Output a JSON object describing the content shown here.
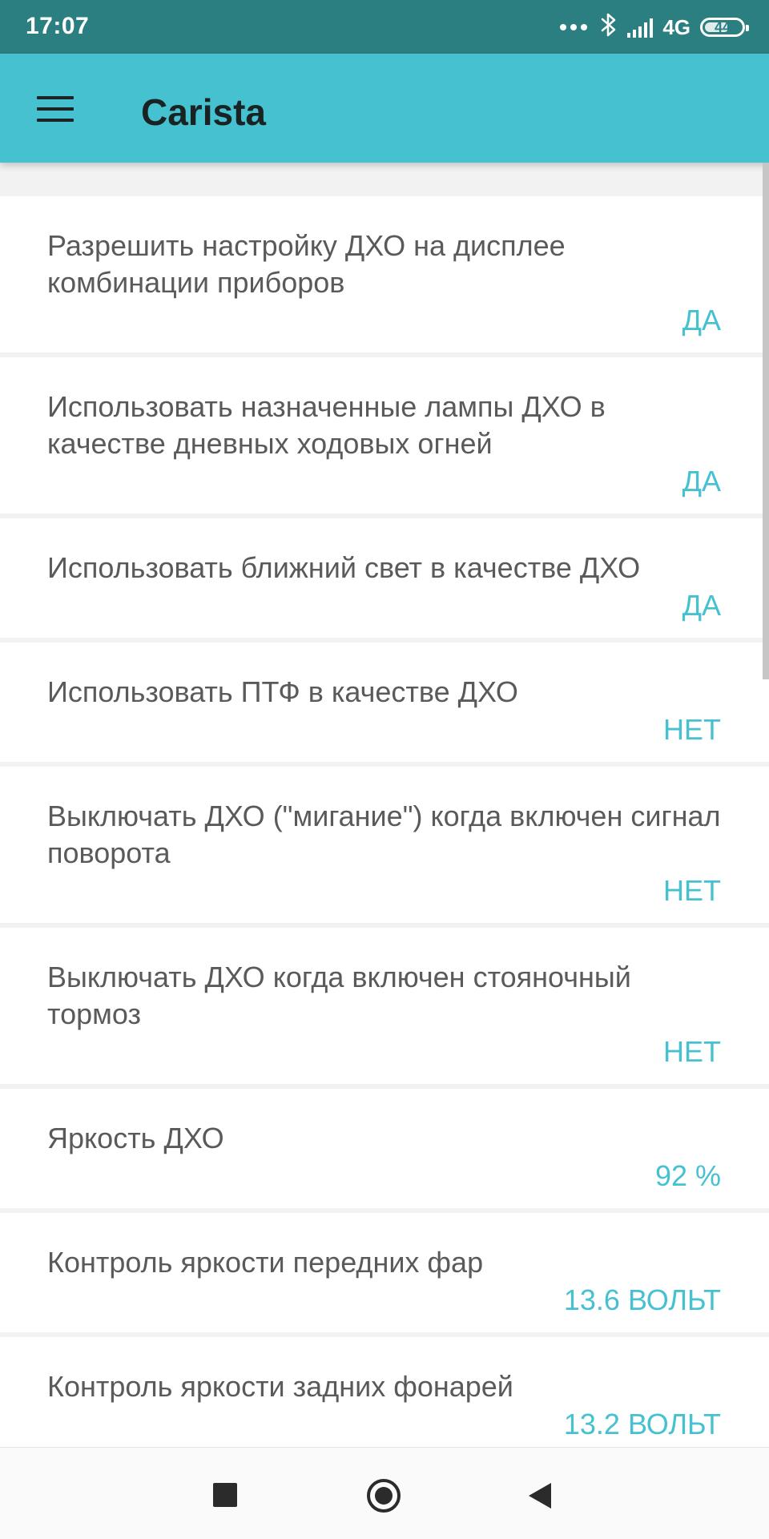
{
  "status_bar": {
    "time": "17:07",
    "network": "4G",
    "battery": "44",
    "icons": [
      "more-dots-icon",
      "bluetooth-icon",
      "signal-icon",
      "battery-icon"
    ]
  },
  "app_bar": {
    "title": "Carista",
    "menu_icon": "hamburger-menu-icon"
  },
  "colors": {
    "status_bar": "#2b7f80",
    "app_bar": "#45c1d0",
    "accent_value": "#45c1d0",
    "background": "#f2f2f2"
  },
  "settings": [
    {
      "title": "Разрешить настройку ДХО на дисплее комбинации приборов",
      "value": "ДА"
    },
    {
      "title": "Использовать назначенные лампы ДХО в качестве дневных ходовых огней",
      "value": "ДА"
    },
    {
      "title": "Использовать ближний свет в качестве ДХО",
      "value": "ДА"
    },
    {
      "title": "Использовать ПТФ в качестве ДХО",
      "value": "НЕТ"
    },
    {
      "title": "Выключать ДХО (\"мигание\") когда включен сигнал поворота",
      "value": "НЕТ"
    },
    {
      "title": "Выключать ДХО когда включен стояночный тормоз",
      "value": "НЕТ"
    },
    {
      "title": "Яркость ДХО",
      "value": "92 %"
    },
    {
      "title": "Контроль яркости передних фар",
      "value": "13.6 ВОЛЬТ"
    },
    {
      "title": "Контроль яркости задних фонарей",
      "value": "13.2 ВОЛЬТ"
    }
  ],
  "nav_bar": {
    "icons": [
      "recents-square-icon",
      "home-circle-icon",
      "back-triangle-icon"
    ]
  }
}
